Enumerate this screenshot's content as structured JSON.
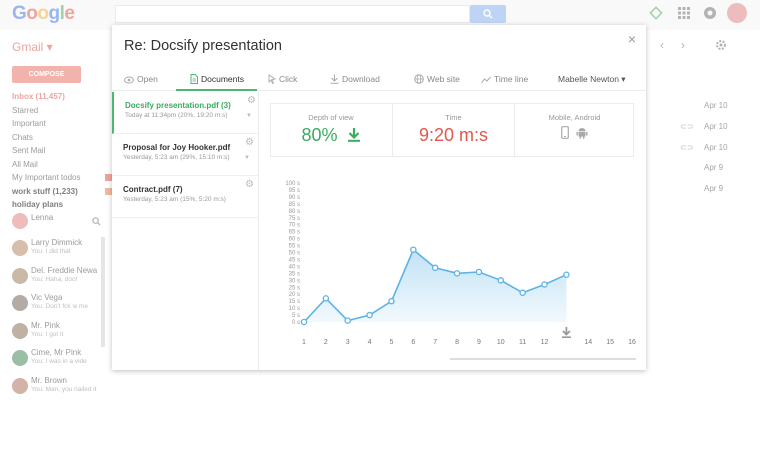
{
  "gmail": {
    "logo": [
      {
        "ch": "G",
        "color": "#7a9ee8"
      },
      {
        "ch": "o",
        "color": "#e9877d"
      },
      {
        "ch": "o",
        "color": "#f2c86c"
      },
      {
        "ch": "g",
        "color": "#7a9ee8"
      },
      {
        "ch": "l",
        "color": "#7fc48d"
      },
      {
        "ch": "e",
        "color": "#e9877d"
      }
    ],
    "label": "Gmail ▾",
    "compose": "COMPOSE",
    "nav": [
      {
        "label": "Inbox (11,457)",
        "style": "red"
      },
      {
        "label": "Starred",
        "style": ""
      },
      {
        "label": "Important",
        "style": ""
      },
      {
        "label": "Chats",
        "style": ""
      },
      {
        "label": "Sent Mail",
        "style": ""
      },
      {
        "label": "All Mail",
        "style": ""
      },
      {
        "label": "My Important todos",
        "style": "",
        "swatch": "#e9877d"
      },
      {
        "label": "work stuff (1,233)",
        "style": "bold",
        "swatch": "#f0a07a"
      },
      {
        "label": "holiday plans",
        "style": "bold"
      }
    ],
    "chat_user": "Lenna",
    "chats": [
      {
        "name": "Larry Dimmick",
        "msg": "You: I did that"
      },
      {
        "name": "Del. Freddie Newa",
        "msg": "You: Haha, doo!"
      },
      {
        "name": "Vic Vega",
        "msg": "You: Don't fck w me"
      },
      {
        "name": "Mr. Pink",
        "msg": "You: I got it"
      },
      {
        "name": "Cime, Mr Pink",
        "msg": "You: I was in a vide"
      },
      {
        "name": "Mr. Brown",
        "msg": "You: Man, you nailed it"
      }
    ],
    "dates": [
      "Apr 10",
      "Apr 10",
      "Apr 10",
      "Apr 9",
      "Apr 9"
    ]
  },
  "modal": {
    "title": "Re: Docsify presentation",
    "close": "×",
    "tabs": [
      {
        "label": "Open",
        "icon": "eye-icon"
      },
      {
        "label": "Documents",
        "icon": "document-icon",
        "active": true
      },
      {
        "label": "Click",
        "icon": "cursor-icon"
      },
      {
        "label": "Download",
        "icon": "download-icon"
      },
      {
        "label": "Web site",
        "icon": "globe-icon"
      },
      {
        "label": "Time line",
        "icon": "timeline-icon"
      },
      {
        "label": "Mabelle Newton ▾",
        "icon": ""
      }
    ],
    "documents": [
      {
        "name": "Docsify presentation.pdf (3)",
        "meta": "Today at 11:34pm (20%, 19:20 m:s)",
        "active": true
      },
      {
        "name": "Proposal for Joy Hooker.pdf",
        "meta": "Yesterday, 5:23 am (29%, 15:10 m:s)",
        "active": false
      },
      {
        "name": "Contract.pdf (7)",
        "meta": "Yesterday, 5:23 am (15%, 5:20 m:s)",
        "active": false
      }
    ],
    "stats": {
      "depth_label": "Depth of view",
      "depth_value": "80%",
      "time_label": "Time",
      "time_value": "9:20 m:s",
      "device_label": "Mobile, Android"
    }
  },
  "chart_data": {
    "type": "area",
    "x": [
      1,
      2,
      3,
      4,
      5,
      6,
      7,
      8,
      9,
      10,
      11,
      12,
      13
    ],
    "y": [
      0,
      17,
      1,
      5,
      15,
      52,
      39,
      35,
      36,
      30,
      21,
      27,
      34
    ],
    "x_ticks": [
      "1",
      "2",
      "3",
      "4",
      "5",
      "6",
      "7",
      "8",
      "9",
      "10",
      "11",
      "12",
      "13",
      "14",
      "15",
      "16"
    ],
    "y_ticks": [
      "0 s",
      "5 s",
      "10 s",
      "15 s",
      "20 s",
      "25 s",
      "30 s",
      "35 s",
      "40 s",
      "45 s",
      "50 s",
      "55 s",
      "60 s",
      "65 s",
      "70 s",
      "75 s",
      "80 s",
      "85 s",
      "90 s",
      "95 s",
      "100 s"
    ],
    "xlim": [
      1,
      16
    ],
    "ylim": [
      0,
      100
    ],
    "highlight_x": 13,
    "color": "#5db3e6",
    "grid": false
  }
}
